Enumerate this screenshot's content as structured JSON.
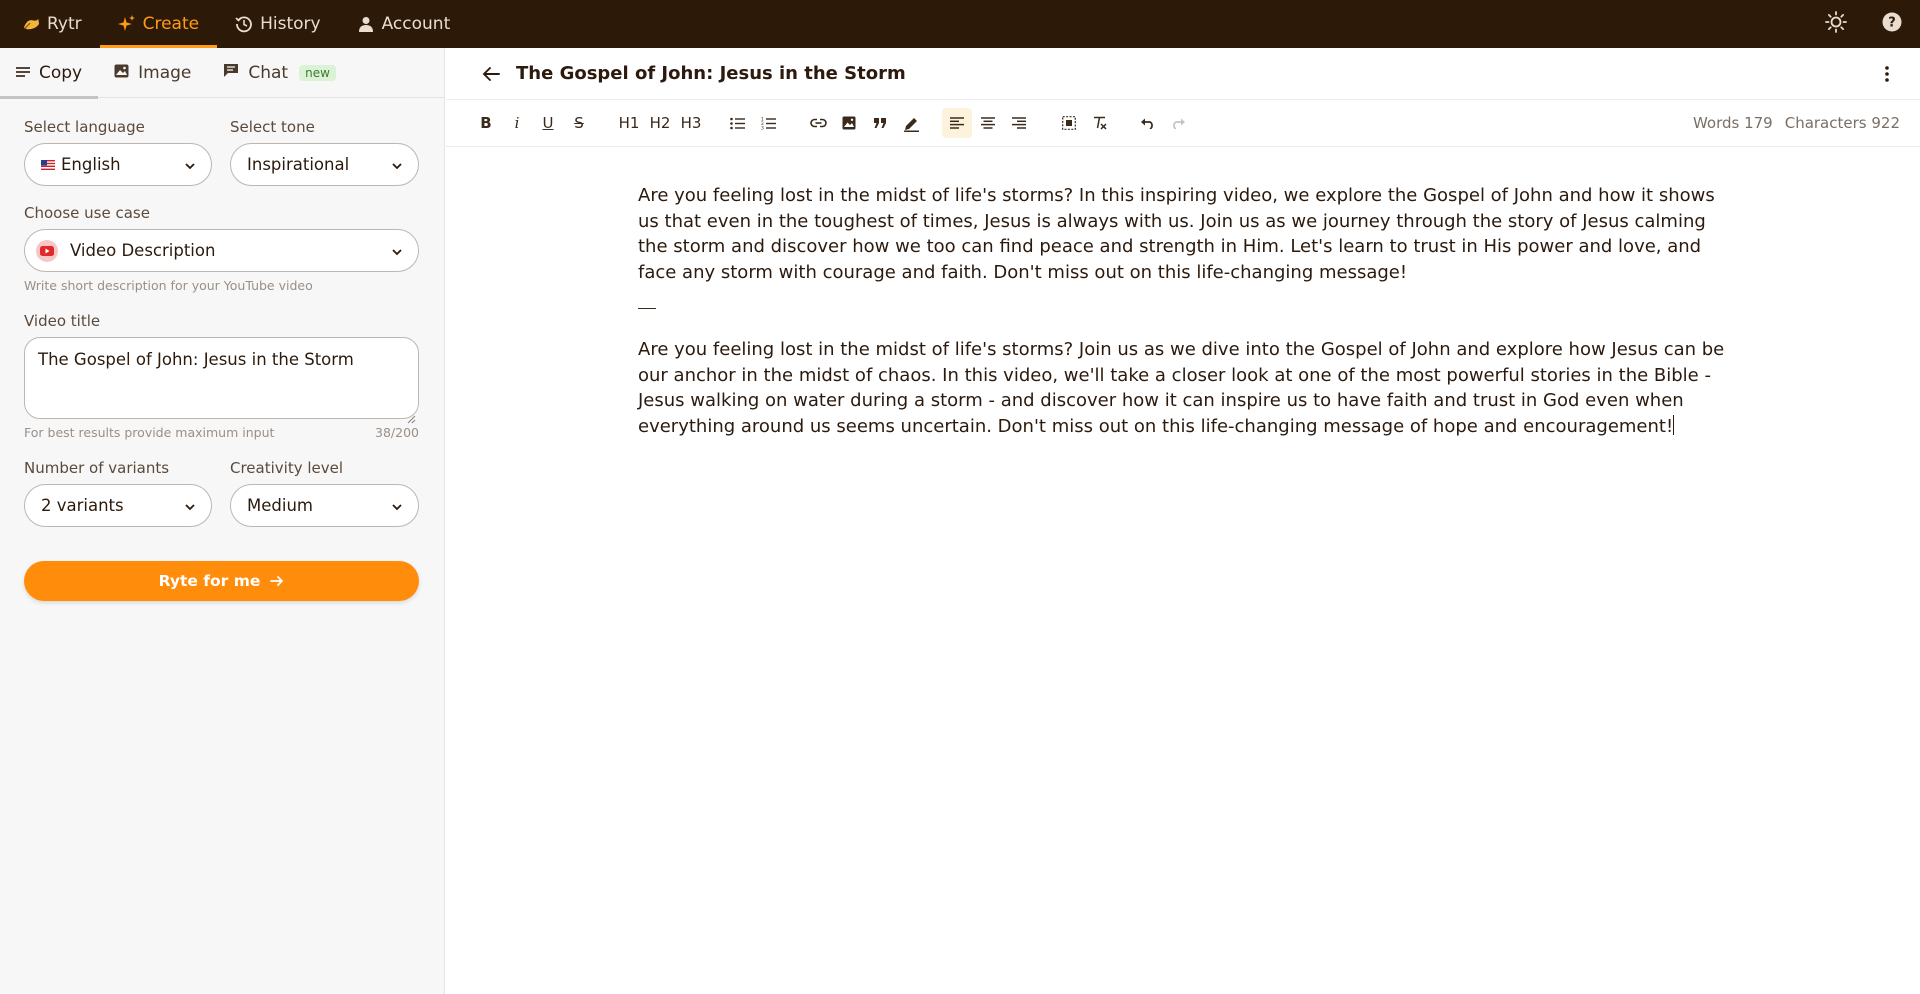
{
  "nav": {
    "brand": "Rytr",
    "items": [
      {
        "label": "Create"
      },
      {
        "label": "History"
      },
      {
        "label": "Account"
      }
    ],
    "accent": "#ff9d16",
    "bg": "#2c1908"
  },
  "sidebar": {
    "tabs": [
      {
        "label": "Copy"
      },
      {
        "label": "Image"
      },
      {
        "label": "Chat"
      }
    ],
    "chat_badge": "new",
    "language_label": "Select language",
    "language_value": "English",
    "tone_label": "Select tone",
    "tone_value": "Inspirational",
    "use_case_label": "Choose use case",
    "use_case_value": "Video Description",
    "use_case_hint": "Write short description for your YouTube video",
    "video_title_label": "Video title",
    "video_title_value": "The Gospel of John: Jesus in the Storm",
    "input_hint": "For best results provide maximum input",
    "char_counter": "38/200",
    "variants_label": "Number of variants",
    "variants_value": "2 variants",
    "creativity_label": "Creativity level",
    "creativity_value": "Medium",
    "submit_label": "Ryte for me"
  },
  "editor": {
    "title": "The Gospel of John: Jesus in the Storm",
    "toolbar": {
      "bold": "B",
      "italic": "i",
      "underline": "U",
      "strike": "S",
      "h1": "H1",
      "h2": "H2",
      "h3": "H3"
    },
    "words_label": "Words 179",
    "chars_label": "Characters 922",
    "paragraph_1": "Are you feeling lost in the midst of life's storms? In this inspiring video, we explore the Gospel of John and how it shows us that even in the toughest of times, Jesus is always with us. Join us as we journey through the story of Jesus calming the storm and discover how we too can find peace and strength in Him. Let's learn to trust in His power and love, and face any storm with courage and faith. Don't miss out on this life-changing message!",
    "paragraph_2": "Are you feeling lost in the midst of life's storms? Join us as we dive into the Gospel of John and explore how Jesus can be our anchor in the midst of chaos. In this video, we'll take a closer look at one of the most powerful stories in the Bible - Jesus walking on water during a storm - and discover how it can inspire us to have faith and trust in God even when everything around us seems uncertain. Don't miss out on this life-changing message of hope and encouragement!"
  },
  "colors": {
    "primary_button": "#ff8c0a",
    "sidebar_bg": "#f7f7f7"
  }
}
